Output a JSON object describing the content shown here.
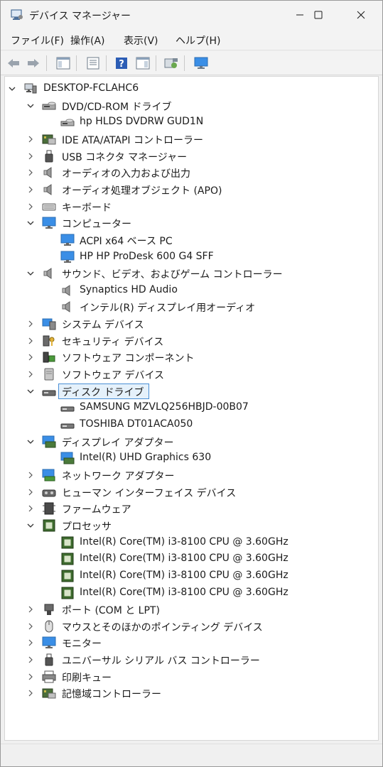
{
  "window": {
    "title": "デバイス マネージャー"
  },
  "menu": [
    "ファイル(F)",
    "操作(A)",
    "表示(V)",
    "ヘルプ(H)"
  ],
  "tree": {
    "root": "DESKTOP-FCLAHC6",
    "nodes": [
      {
        "label": "DVD/CD-ROM ドライブ",
        "expanded": true,
        "icon": "dvd-drive-icon",
        "children": [
          "hp HLDS DVDRW  GUD1N"
        ]
      },
      {
        "label": "IDE ATA/ATAPI コントローラー",
        "expanded": false,
        "icon": "ide-controller-icon"
      },
      {
        "label": "USB コネクタ マネージャー",
        "expanded": false,
        "icon": "usb-icon"
      },
      {
        "label": "オーディオの入力および出力",
        "expanded": false,
        "icon": "speaker-icon"
      },
      {
        "label": "オーディオ処理オブジェクト (APO)",
        "expanded": false,
        "icon": "speaker-icon"
      },
      {
        "label": "キーボード",
        "expanded": false,
        "icon": "keyboard-icon"
      },
      {
        "label": "コンピューター",
        "expanded": true,
        "icon": "monitor-icon",
        "children": [
          "ACPI x64 ベース PC",
          "HP HP ProDesk 600 G4 SFF"
        ]
      },
      {
        "label": "サウンド、ビデオ、およびゲーム コントローラー",
        "expanded": true,
        "icon": "speaker-icon",
        "children": [
          "Synaptics HD Audio",
          "インテル(R) ディスプレイ用オーディオ"
        ]
      },
      {
        "label": "システム デバイス",
        "expanded": false,
        "icon": "system-device-icon"
      },
      {
        "label": "セキュリティ デバイス",
        "expanded": false,
        "icon": "security-key-icon"
      },
      {
        "label": "ソフトウェア コンポーネント",
        "expanded": false,
        "icon": "software-component-icon"
      },
      {
        "label": "ソフトウェア デバイス",
        "expanded": false,
        "icon": "software-device-icon"
      },
      {
        "label": "ディスク ドライブ",
        "expanded": true,
        "selected": true,
        "icon": "disk-drive-icon",
        "children": [
          "SAMSUNG MZVLQ256HBJD-00B07",
          "TOSHIBA DT01ACA050"
        ]
      },
      {
        "label": "ディスプレイ アダプター",
        "expanded": true,
        "icon": "display-adapter-icon",
        "children": [
          "Intel(R) UHD Graphics 630"
        ]
      },
      {
        "label": "ネットワーク アダプター",
        "expanded": false,
        "icon": "network-adapter-icon"
      },
      {
        "label": "ヒューマン インターフェイス デバイス",
        "expanded": false,
        "icon": "hid-icon"
      },
      {
        "label": "ファームウェア",
        "expanded": false,
        "icon": "firmware-icon"
      },
      {
        "label": "プロセッサ",
        "expanded": true,
        "icon": "processor-icon",
        "children": [
          "Intel(R) Core(TM) i3-8100 CPU @ 3.60GHz",
          "Intel(R) Core(TM) i3-8100 CPU @ 3.60GHz",
          "Intel(R) Core(TM) i3-8100 CPU @ 3.60GHz",
          "Intel(R) Core(TM) i3-8100 CPU @ 3.60GHz"
        ]
      },
      {
        "label": "ポート (COM と LPT)",
        "expanded": false,
        "icon": "port-icon"
      },
      {
        "label": "マウスとそのほかのポインティング デバイス",
        "expanded": false,
        "icon": "mouse-icon"
      },
      {
        "label": "モニター",
        "expanded": false,
        "icon": "monitor-icon"
      },
      {
        "label": "ユニバーサル シリアル バス コントローラー",
        "expanded": false,
        "icon": "usb-icon"
      },
      {
        "label": "印刷キュー",
        "expanded": false,
        "icon": "printer-icon"
      },
      {
        "label": "記憶域コントローラー",
        "expanded": false,
        "icon": "storage-controller-icon"
      }
    ]
  },
  "colors": {
    "selection_border": "#4a8fd6",
    "selection_fill": "#e5f1fb",
    "monitor_blue": "#2b7cd3",
    "processor_green": "#3e6b2e"
  }
}
